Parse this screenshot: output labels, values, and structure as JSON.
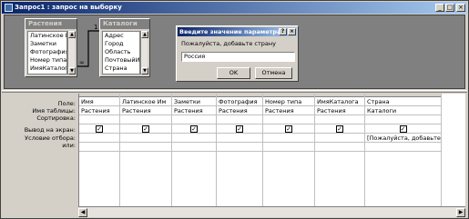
{
  "window": {
    "title": "Запрос1 : запрос на выборку",
    "minimize": "_",
    "maximize": "□",
    "close": "×"
  },
  "tables": [
    {
      "name": "Растения",
      "fields": [
        "Латинское Им",
        "Заметки",
        "Фотография",
        "Номер типа",
        "ИмяКаталога"
      ]
    },
    {
      "name": "Каталоги",
      "fields": [
        "Адрес",
        "Город",
        "Область",
        "ПочтовыйИн",
        "Страна"
      ]
    }
  ],
  "grid": {
    "row_labels": [
      "Поле:",
      "Имя таблицы:",
      "Сортировка:",
      "Вывод на экран:",
      "Условие отбора:",
      "или:"
    ],
    "columns": [
      {
        "field": "Имя",
        "table": "Растения",
        "show": true,
        "criteria": ""
      },
      {
        "field": "Латинское Им",
        "table": "Растения",
        "show": true,
        "criteria": ""
      },
      {
        "field": "Заметки",
        "table": "Растения",
        "show": true,
        "criteria": ""
      },
      {
        "field": "Фотография",
        "table": "Растения",
        "show": true,
        "criteria": ""
      },
      {
        "field": "Номер типа",
        "table": "Растения",
        "show": true,
        "criteria": ""
      },
      {
        "field": "ИмяКаталога",
        "table": "Растения",
        "show": true,
        "criteria": ""
      },
      {
        "field": "Страна",
        "table": "Каталоги",
        "show": true,
        "criteria": "[Пожалуйста, добавьте страну"
      }
    ]
  },
  "dialog": {
    "title": "Введите значение параметра",
    "help": "?",
    "close": "×",
    "prompt": "Пожалуйста, добавьте страну",
    "value": "Россия",
    "ok_label": "OK",
    "cancel_label": "Отмена"
  }
}
